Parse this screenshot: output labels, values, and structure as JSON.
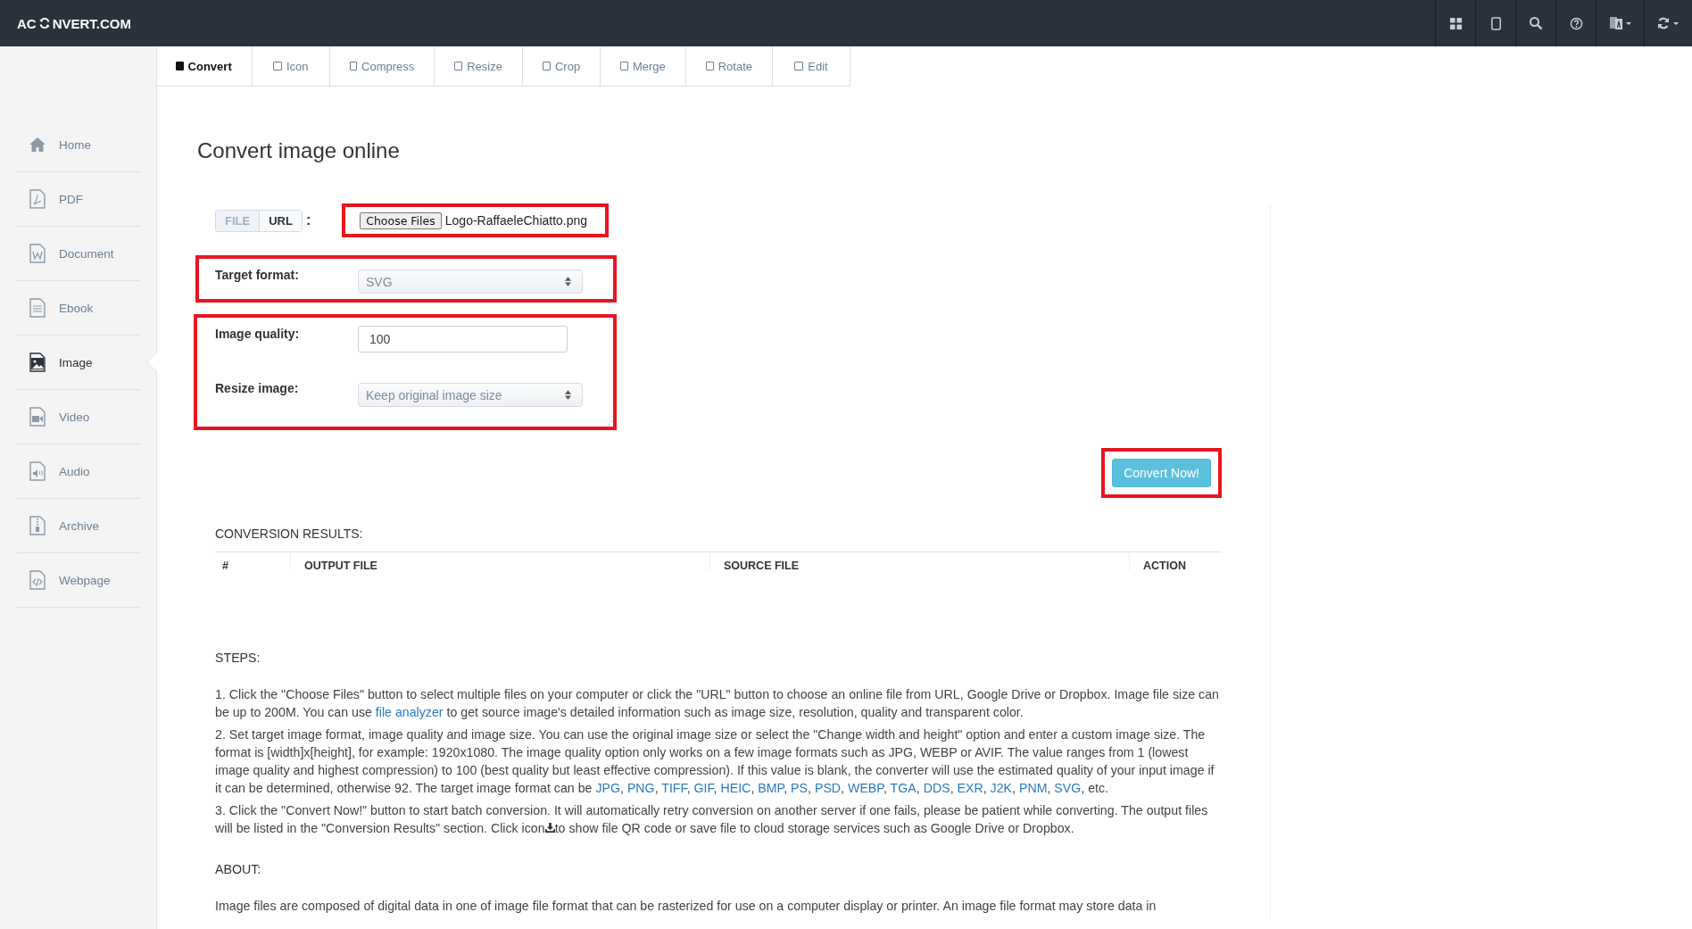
{
  "brand": {
    "before": "AC",
    "after": "NVERT.COM"
  },
  "top_buttons": [
    {
      "kind": "grid"
    },
    {
      "kind": "tablet"
    },
    {
      "kind": "search"
    },
    {
      "kind": "help"
    },
    {
      "kind": "translate"
    },
    {
      "kind": "refresh"
    }
  ],
  "tabs": [
    {
      "label": "Convert",
      "selected": true
    },
    {
      "label": "Icon",
      "selected": false
    },
    {
      "label": "Compress",
      "selected": false
    },
    {
      "label": "Resize",
      "selected": false
    },
    {
      "label": "Crop",
      "selected": false
    },
    {
      "label": "Merge",
      "selected": false
    },
    {
      "label": "Rotate",
      "selected": false
    },
    {
      "label": "Edit",
      "selected": false
    }
  ],
  "sidebar": {
    "items": [
      {
        "label": "Home",
        "kind": "home",
        "selected": false
      },
      {
        "label": "PDF",
        "kind": "pdf",
        "selected": false
      },
      {
        "label": "Document",
        "kind": "document",
        "selected": false
      },
      {
        "label": "Ebook",
        "kind": "ebook",
        "selected": false
      },
      {
        "label": "Image",
        "kind": "image",
        "selected": true
      },
      {
        "label": "Video",
        "kind": "video",
        "selected": false
      },
      {
        "label": "Audio",
        "kind": "audio",
        "selected": false
      },
      {
        "label": "Archive",
        "kind": "archive",
        "selected": false
      },
      {
        "label": "Webpage",
        "kind": "webpage",
        "selected": false
      }
    ]
  },
  "title": "Convert image online",
  "source_toggle": [
    {
      "label": "FILE",
      "selected": false
    },
    {
      "label": "URL",
      "selected": true
    }
  ],
  "source_colon": ":",
  "file_input": {
    "button": "Choose Files",
    "value": "Logo-RaffaeleChiatto.png"
  },
  "target_format": {
    "label": "Target format:",
    "value": "SVG"
  },
  "image_quality": {
    "label": "Image quality:",
    "value": "100"
  },
  "resize_image": {
    "label": "Resize image:",
    "value": "Keep original image size"
  },
  "convert_button": "Convert Now!",
  "results": {
    "title": "CONVERSION RESULTS:",
    "columns": [
      "#",
      "OUTPUT FILE",
      "SOURCE FILE",
      "ACTION"
    ]
  },
  "steps_title": "STEPS:",
  "steps": [
    [
      {
        "kind": "text",
        "text": "1. Click the \"Choose Files\" button to select multiple files on your computer or click the \"URL\" button to choose an online file from URL, Google Drive or Dropbox. Image file size can be up to 200M. You can use "
      },
      {
        "kind": "link",
        "text": "file analyzer"
      },
      {
        "kind": "text",
        "text": " to get source image's detailed information such as image size, resolution, quality and transparent color."
      }
    ],
    [
      {
        "kind": "text",
        "text": "2. Set target image format, image quality and image size. You can use the original image size or select the \"Change width and height\" option and enter a custom image size. The format is [width]x[height], for example: 1920x1080. The image quality option only works on a few image formats such as JPG, WEBP or AVIF. The value ranges from 1 (lowest image quality and highest compression) to 100 (best quality but least effective compression). If this value is blank, the converter will use the estimated quality of your input image if it can be determined, otherwise 92. The target image format can be "
      },
      {
        "kind": "link",
        "text": "JPG"
      },
      {
        "kind": "text",
        "text": ", "
      },
      {
        "kind": "link",
        "text": "PNG"
      },
      {
        "kind": "text",
        "text": ", "
      },
      {
        "kind": "link",
        "text": "TIFF"
      },
      {
        "kind": "text",
        "text": ", "
      },
      {
        "kind": "link",
        "text": "GIF"
      },
      {
        "kind": "text",
        "text": ", "
      },
      {
        "kind": "link",
        "text": "HEIC"
      },
      {
        "kind": "text",
        "text": ", "
      },
      {
        "kind": "link",
        "text": "BMP"
      },
      {
        "kind": "text",
        "text": ", "
      },
      {
        "kind": "link",
        "text": "PS"
      },
      {
        "kind": "text",
        "text": ", "
      },
      {
        "kind": "link",
        "text": "PSD"
      },
      {
        "kind": "text",
        "text": ", "
      },
      {
        "kind": "link",
        "text": "WEBP"
      },
      {
        "kind": "text",
        "text": ", "
      },
      {
        "kind": "link",
        "text": "TGA"
      },
      {
        "kind": "text",
        "text": ", "
      },
      {
        "kind": "link",
        "text": "DDS"
      },
      {
        "kind": "text",
        "text": ", "
      },
      {
        "kind": "link",
        "text": "EXR"
      },
      {
        "kind": "text",
        "text": ", "
      },
      {
        "kind": "link",
        "text": "J2K"
      },
      {
        "kind": "text",
        "text": ", "
      },
      {
        "kind": "link",
        "text": "PNM"
      },
      {
        "kind": "text",
        "text": ", "
      },
      {
        "kind": "link",
        "text": "SVG"
      },
      {
        "kind": "text",
        "text": ", etc."
      }
    ],
    [
      {
        "kind": "text",
        "text": "3. Click the \"Convert Now!\" button to start batch conversion. It will automatically retry conversion on another server if one fails, please be patient while converting. The output files will be listed in the \"Conversion Results\" section. Click icon"
      },
      {
        "kind": "download_icon"
      },
      {
        "kind": "text",
        "text": "to show file QR code or save file to cloud storage services such as Google Drive or Dropbox."
      }
    ]
  ],
  "about_title": "ABOUT:",
  "about_text": "Image files are composed of digital data in one of image file format that can be rasterized for use on a computer display or printer. An image file format may store data in"
}
